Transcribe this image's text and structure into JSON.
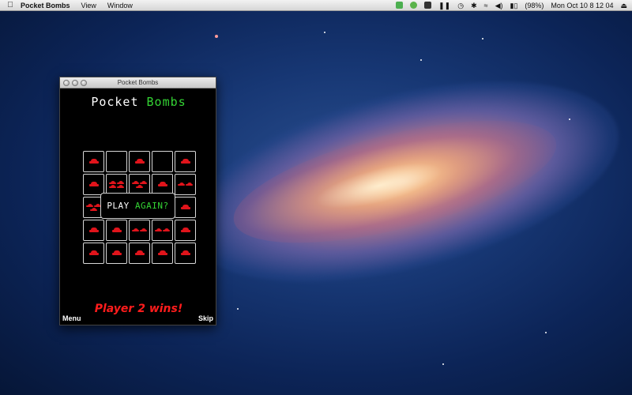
{
  "menubar": {
    "apple": "",
    "app_name": "Pocket Bombs",
    "menus": [
      "View",
      "Window"
    ],
    "status_battery": "(98%)",
    "clock": "Mon Oct 10  8 12 04",
    "status_icons": [
      "evernote-icon",
      "app-icon",
      "b-icon",
      "pause-icon",
      "time-machine-icon",
      "bluetooth-icon",
      "wifi-icon",
      "volume-icon",
      "battery-icon",
      "eject-icon"
    ]
  },
  "window": {
    "title": "Pocket Bombs",
    "logo_part1": "Pocket",
    "logo_part2": "Bombs",
    "play_again_part1": "PLAY",
    "play_again_part2": "AGAIN?",
    "status_message": "Player 2 wins!",
    "menu_label": "Menu",
    "skip_label": "Skip"
  },
  "board": {
    "rows": [
      [
        1,
        0,
        1,
        0,
        1
      ],
      [
        1,
        4,
        3,
        1,
        2
      ],
      [
        3,
        0,
        0,
        0,
        1
      ],
      [
        1,
        1,
        2,
        2,
        1
      ],
      [
        1,
        1,
        1,
        1,
        1
      ]
    ]
  },
  "colors": {
    "accent_green": "#34d334",
    "bomb_red": "#e0141b",
    "winner_red": "#ff1c1c"
  }
}
